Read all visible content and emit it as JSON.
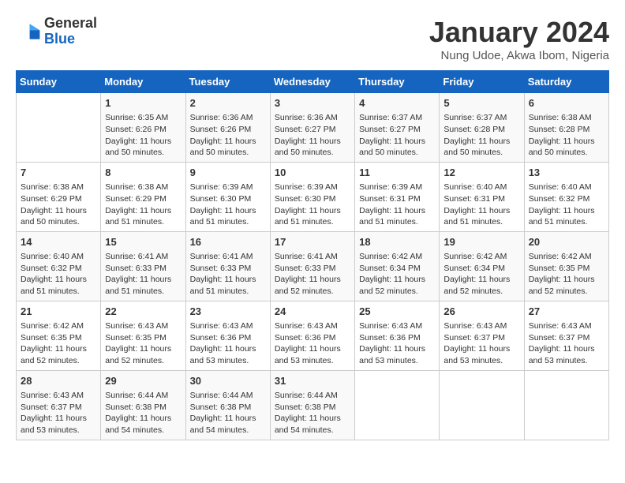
{
  "header": {
    "logo_general": "General",
    "logo_blue": "Blue",
    "title": "January 2024",
    "location": "Nung Udoe, Akwa Ibom, Nigeria"
  },
  "days_of_week": [
    "Sunday",
    "Monday",
    "Tuesday",
    "Wednesday",
    "Thursday",
    "Friday",
    "Saturday"
  ],
  "weeks": [
    [
      {
        "day": "",
        "content": ""
      },
      {
        "day": "1",
        "content": "Sunrise: 6:35 AM\nSunset: 6:26 PM\nDaylight: 11 hours and 50 minutes."
      },
      {
        "day": "2",
        "content": "Sunrise: 6:36 AM\nSunset: 6:26 PM\nDaylight: 11 hours and 50 minutes."
      },
      {
        "day": "3",
        "content": "Sunrise: 6:36 AM\nSunset: 6:27 PM\nDaylight: 11 hours and 50 minutes."
      },
      {
        "day": "4",
        "content": "Sunrise: 6:37 AM\nSunset: 6:27 PM\nDaylight: 11 hours and 50 minutes."
      },
      {
        "day": "5",
        "content": "Sunrise: 6:37 AM\nSunset: 6:28 PM\nDaylight: 11 hours and 50 minutes."
      },
      {
        "day": "6",
        "content": "Sunrise: 6:38 AM\nSunset: 6:28 PM\nDaylight: 11 hours and 50 minutes."
      }
    ],
    [
      {
        "day": "7",
        "content": "Sunrise: 6:38 AM\nSunset: 6:29 PM\nDaylight: 11 hours and 50 minutes."
      },
      {
        "day": "8",
        "content": "Sunrise: 6:38 AM\nSunset: 6:29 PM\nDaylight: 11 hours and 51 minutes."
      },
      {
        "day": "9",
        "content": "Sunrise: 6:39 AM\nSunset: 6:30 PM\nDaylight: 11 hours and 51 minutes."
      },
      {
        "day": "10",
        "content": "Sunrise: 6:39 AM\nSunset: 6:30 PM\nDaylight: 11 hours and 51 minutes."
      },
      {
        "day": "11",
        "content": "Sunrise: 6:39 AM\nSunset: 6:31 PM\nDaylight: 11 hours and 51 minutes."
      },
      {
        "day": "12",
        "content": "Sunrise: 6:40 AM\nSunset: 6:31 PM\nDaylight: 11 hours and 51 minutes."
      },
      {
        "day": "13",
        "content": "Sunrise: 6:40 AM\nSunset: 6:32 PM\nDaylight: 11 hours and 51 minutes."
      }
    ],
    [
      {
        "day": "14",
        "content": "Sunrise: 6:40 AM\nSunset: 6:32 PM\nDaylight: 11 hours and 51 minutes."
      },
      {
        "day": "15",
        "content": "Sunrise: 6:41 AM\nSunset: 6:33 PM\nDaylight: 11 hours and 51 minutes."
      },
      {
        "day": "16",
        "content": "Sunrise: 6:41 AM\nSunset: 6:33 PM\nDaylight: 11 hours and 51 minutes."
      },
      {
        "day": "17",
        "content": "Sunrise: 6:41 AM\nSunset: 6:33 PM\nDaylight: 11 hours and 52 minutes."
      },
      {
        "day": "18",
        "content": "Sunrise: 6:42 AM\nSunset: 6:34 PM\nDaylight: 11 hours and 52 minutes."
      },
      {
        "day": "19",
        "content": "Sunrise: 6:42 AM\nSunset: 6:34 PM\nDaylight: 11 hours and 52 minutes."
      },
      {
        "day": "20",
        "content": "Sunrise: 6:42 AM\nSunset: 6:35 PM\nDaylight: 11 hours and 52 minutes."
      }
    ],
    [
      {
        "day": "21",
        "content": "Sunrise: 6:42 AM\nSunset: 6:35 PM\nDaylight: 11 hours and 52 minutes."
      },
      {
        "day": "22",
        "content": "Sunrise: 6:43 AM\nSunset: 6:35 PM\nDaylight: 11 hours and 52 minutes."
      },
      {
        "day": "23",
        "content": "Sunrise: 6:43 AM\nSunset: 6:36 PM\nDaylight: 11 hours and 53 minutes."
      },
      {
        "day": "24",
        "content": "Sunrise: 6:43 AM\nSunset: 6:36 PM\nDaylight: 11 hours and 53 minutes."
      },
      {
        "day": "25",
        "content": "Sunrise: 6:43 AM\nSunset: 6:36 PM\nDaylight: 11 hours and 53 minutes."
      },
      {
        "day": "26",
        "content": "Sunrise: 6:43 AM\nSunset: 6:37 PM\nDaylight: 11 hours and 53 minutes."
      },
      {
        "day": "27",
        "content": "Sunrise: 6:43 AM\nSunset: 6:37 PM\nDaylight: 11 hours and 53 minutes."
      }
    ],
    [
      {
        "day": "28",
        "content": "Sunrise: 6:43 AM\nSunset: 6:37 PM\nDaylight: 11 hours and 53 minutes."
      },
      {
        "day": "29",
        "content": "Sunrise: 6:44 AM\nSunset: 6:38 PM\nDaylight: 11 hours and 54 minutes."
      },
      {
        "day": "30",
        "content": "Sunrise: 6:44 AM\nSunset: 6:38 PM\nDaylight: 11 hours and 54 minutes."
      },
      {
        "day": "31",
        "content": "Sunrise: 6:44 AM\nSunset: 6:38 PM\nDaylight: 11 hours and 54 minutes."
      },
      {
        "day": "",
        "content": ""
      },
      {
        "day": "",
        "content": ""
      },
      {
        "day": "",
        "content": ""
      }
    ]
  ]
}
